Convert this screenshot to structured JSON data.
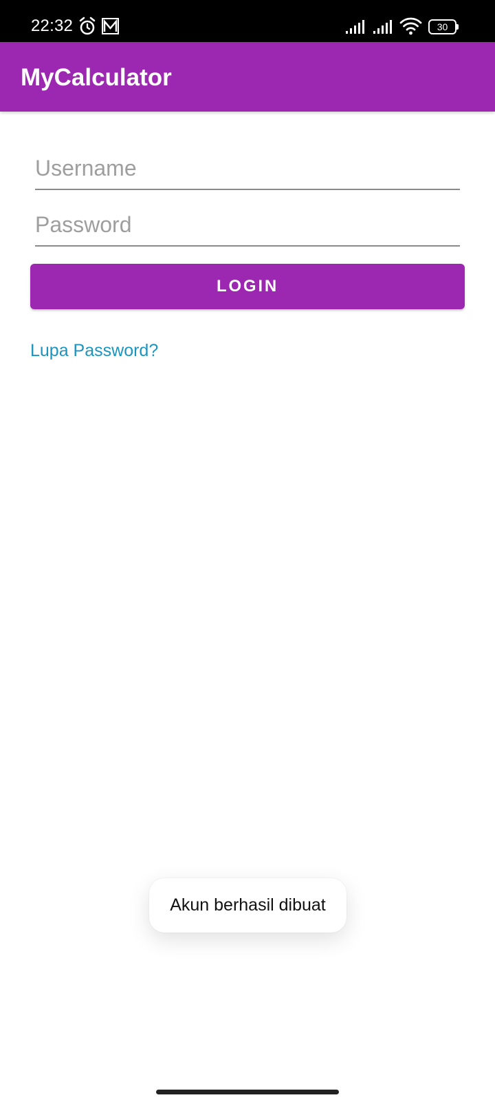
{
  "status_bar": {
    "time": "22:32",
    "battery_level": "30",
    "icons": [
      "alarm-icon",
      "app-m-icon",
      "signal-icon",
      "signal-icon",
      "wifi-icon",
      "battery-icon"
    ]
  },
  "app_bar": {
    "title": "MyCalculator"
  },
  "login_form": {
    "username_placeholder": "Username",
    "username_value": "",
    "password_placeholder": "Password",
    "password_value": "",
    "login_label": "LOGIN",
    "forgot_password_label": "Lupa Password?"
  },
  "toast": {
    "message": "Akun berhasil dibuat"
  },
  "colors": {
    "primary": "#9c27b0",
    "link": "#1b94c0",
    "status_bar": "#000000"
  }
}
